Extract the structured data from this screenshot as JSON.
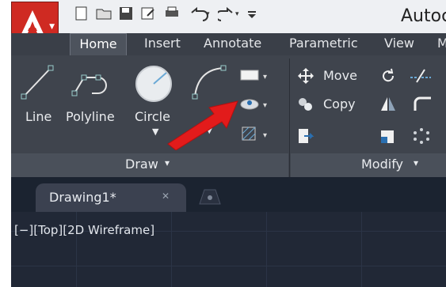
{
  "app_title": "Autoc",
  "ribbon_tabs": [
    "Home",
    "Insert",
    "Annotate",
    "Parametric",
    "View",
    "M"
  ],
  "draw_panel": {
    "tools": [
      {
        "label": "Line",
        "icon": "line-icon"
      },
      {
        "label": "Polyline",
        "icon": "polyline-icon"
      },
      {
        "label": "Circle",
        "icon": "circle-icon"
      }
    ],
    "footer_label": "Draw",
    "footer_arrow": "▾"
  },
  "modify_panel": {
    "tools": [
      {
        "label": "Move",
        "icon": "move-icon"
      },
      {
        "label": "Copy",
        "icon": "copy-icon"
      }
    ],
    "footer_label": "Modify",
    "footer_arrow": "▾"
  },
  "document_tab": {
    "title": "Drawing1*",
    "close": "✕"
  },
  "viewport_label": "[−][Top][2D Wireframe]",
  "colors": {
    "accent": "#cf2a22",
    "ribbon": "#3f444d",
    "viewport": "#212836",
    "arrow": "#e21b1b"
  }
}
